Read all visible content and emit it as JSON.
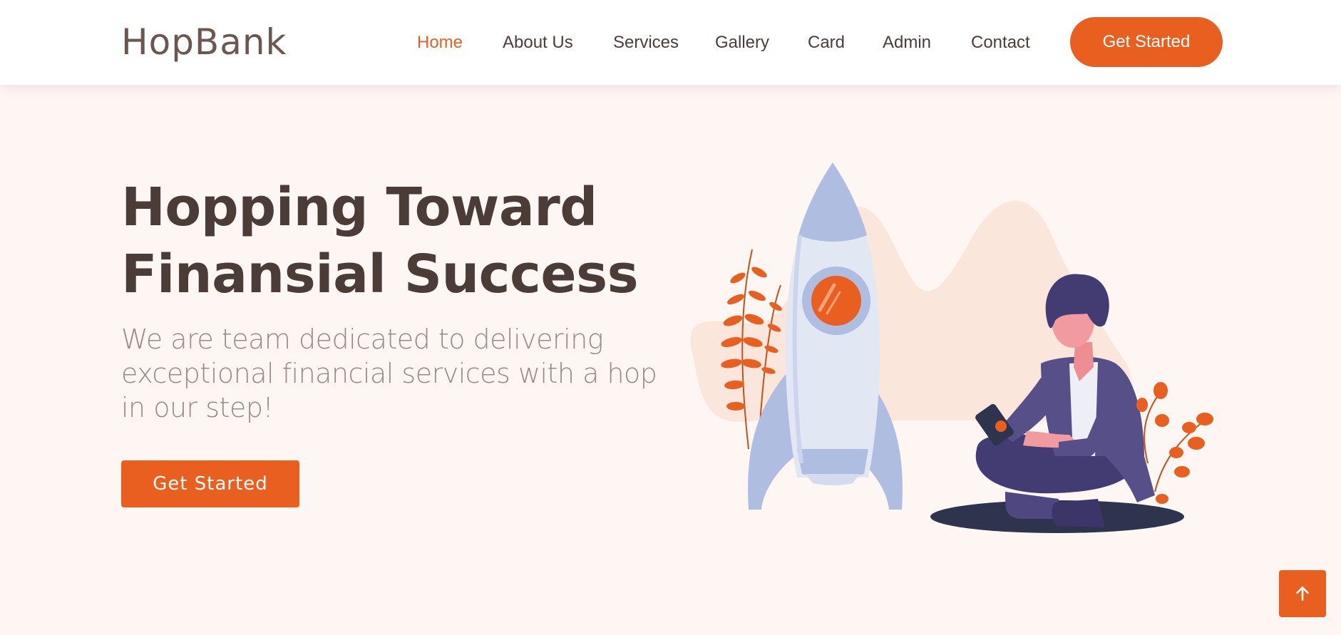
{
  "brand": {
    "name": "HopBank",
    "accent_color": "#e85f20"
  },
  "nav": {
    "items": [
      {
        "label": "Home",
        "active": true
      },
      {
        "label": "About Us",
        "active": false
      },
      {
        "label": "Services",
        "active": false
      },
      {
        "label": "Gallery",
        "active": false
      },
      {
        "label": "Card",
        "active": false
      },
      {
        "label": "Admin",
        "active": false
      },
      {
        "label": "Contact",
        "active": false
      }
    ],
    "cta_label": "Get Started"
  },
  "hero": {
    "title_line1": "Hopping Toward",
    "title_line2": "Finansial Success",
    "subtitle": "We are team dedicated to delivering exceptional financial services with a hop in our step!",
    "cta_label": "Get Started",
    "illustration": "rocket-and-person-illustration"
  },
  "back_to_top": {
    "icon": "arrow-up-icon"
  }
}
